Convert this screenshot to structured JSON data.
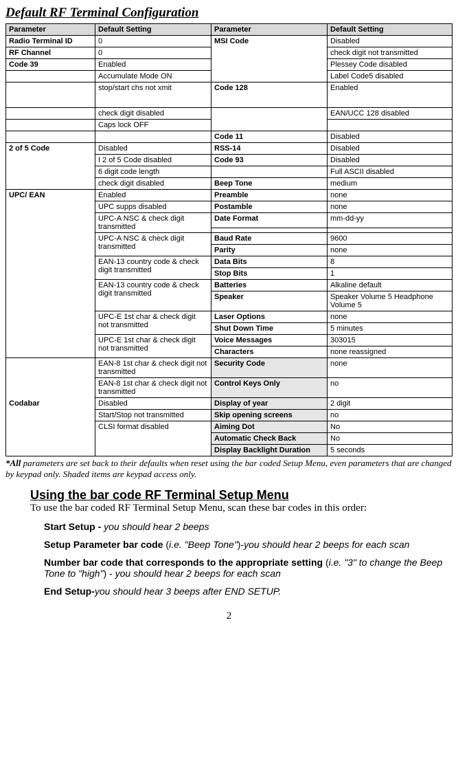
{
  "title": "Default RF Terminal Configuration",
  "headers": {
    "p1": "Parameter",
    "d1": "Default Setting",
    "p2": "Parameter",
    "d2": " Default Setting"
  },
  "left": {
    "radio_terminal_id": {
      "label": "Radio Terminal ID",
      "val": "0"
    },
    "rf_channel": {
      "label": "RF Channel",
      "val": "0"
    },
    "code39": {
      "label": "Code 39",
      "val": "Enabled"
    },
    "accumulate": "Accumulate Mode ON",
    "stopstart": "stop/start chs not xmit",
    "checkdigit_dis": "check digit disabled",
    "capslock": "Caps lock OFF",
    "two_of_five": {
      "label": "2 of 5 Code",
      "r1": "Disabled",
      "r2": "I 2 of 5 Code disabled",
      "r3": "6 digit code length",
      "r4": "check digit disabled"
    },
    "upc_ean": {
      "label": "UPC/ EAN",
      "r1": "Enabled",
      "r2": "UPC supps disabled",
      "r3": "UPC-A NSC & check digit transmitted",
      "r4": "UPC-A NSC & check digit transmitted",
      "r5": "EAN-13 country code & check digit transmitted",
      "r6": "EAN-13 country code & check digit transmitted",
      "r7": "UPC-E 1st char & check digit not transmitted",
      "r8": "UPC-E 1st char & check digit not transmitted",
      "r9": "EAN-8 1st char & check digit not transmitted",
      "r10": "EAN-8 1st char & check digit not transmitted"
    },
    "codabar": {
      "label": "Codabar",
      "r1": "Disabled",
      "r2": "Start/Stop not transmitted",
      "r3": "CLSI format disabled"
    }
  },
  "right": {
    "msi": {
      "label": "MSI Code",
      "v1": "Disabled",
      "v2": "check digit not transmitted",
      "v3": "Plessey Code disabled",
      "v4": "Label Code5 disabled"
    },
    "code128": {
      "label": "Code 128",
      "v1": "Enabled",
      "v2": "EAN/UCC 128 disabled"
    },
    "code11": {
      "label": "Code 11",
      "val": "Disabled"
    },
    "rss14": {
      "label": "RSS-14",
      "val": "Disabled"
    },
    "code93": {
      "label": "Code 93",
      "v1": "Disabled",
      "v2": "Full ASCII disabled"
    },
    "beep": {
      "label": "Beep Tone",
      "val": "medium"
    },
    "preamble": {
      "label": "Preamble",
      "val": "none"
    },
    "postamble": {
      "label": "Postamble",
      "val": "none"
    },
    "date": {
      "label": "Date Format",
      "val": "mm-dd-yy"
    },
    "baud": {
      "label": "Baud Rate",
      "val": "9600"
    },
    "parity": {
      "label": "Parity",
      "val": "none"
    },
    "databits": {
      "label": "Data Bits",
      "val": "8"
    },
    "stopbits": {
      "label": "Stop Bits",
      "val": "1"
    },
    "batteries": {
      "label": "Batteries",
      "val": "Alkaline default"
    },
    "speaker": {
      "label": "Speaker",
      "val": "Speaker Volume 5 Headphone Volume 5"
    },
    "laser": {
      "label": "Laser Options",
      "val": "none"
    },
    "shutdown": {
      "label": "Shut Down Time",
      "val": "5 minutes"
    },
    "voice": {
      "label": "Voice Messages",
      "val": "303015"
    },
    "characters": {
      "label": "Characters",
      "val": "none reassigned"
    },
    "security": {
      "label": "Security Code",
      "val": "none"
    },
    "ctrlkeys": {
      "label": "Control Keys Only",
      "val": "no"
    },
    "dispyear": {
      "label": "Display of year",
      "val": "2 digit"
    },
    "skip": {
      "label": "Skip opening screens",
      "val": "no"
    },
    "aiming": {
      "label": "Aiming Dot",
      "val": "No"
    },
    "autocheck": {
      "label": "Automatic Check Back",
      "val": "No"
    },
    "backlight": {
      "label": "Display Backlight Duration",
      "val": "5 seconds"
    }
  },
  "footnote": {
    "lead": "*All",
    "rest": " parameters are set back to their defaults when reset using the bar coded Setup Menu, even parameters that are changed by keypad only. Shaded items are keypad access only."
  },
  "section2": {
    "title": "Using the bar code RF Terminal Setup Menu",
    "intro": "To use the bar coded RF Terminal Setup Menu, scan these bar codes in this order:",
    "steps": {
      "s1a": "Start Setup - ",
      "s1b": "you should hear 2 beeps",
      "s2a": "Setup Parameter bar code ",
      "s2b": "(",
      "s2c": "i.e. \"Beep Tone\"",
      "s2d": ")-",
      "s2e": "you should hear 2 beeps for each scan",
      "s3a": "Number bar code that corresponds to the appropriate setting ",
      "s3b": "(",
      "s3c": "i.e. \"3\" to change the Beep Tone to \"high\"",
      "s3d": ") - ",
      "s3e": "you should hear 2 beeps for each scan",
      "s4a": "End Setup-",
      "s4b": "you should hear 3 beeps after END SETUP."
    }
  },
  "page": "2"
}
